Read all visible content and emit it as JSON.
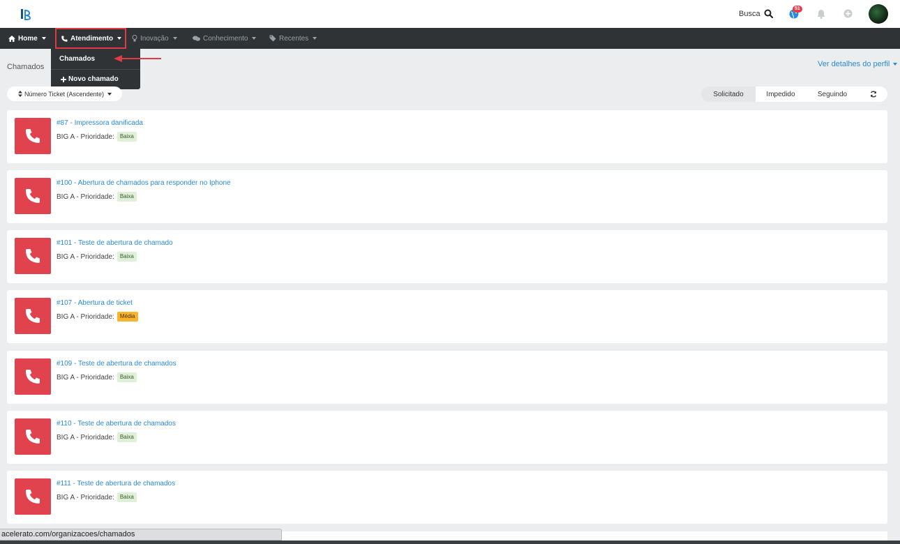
{
  "topbar": {
    "search_label": "Busca",
    "notification_count": "51",
    "icons": [
      "logo-icon",
      "search-icon",
      "globe-icon",
      "bell-icon",
      "plus-circle-icon",
      "avatar"
    ]
  },
  "nav": {
    "items": [
      {
        "label": "Home",
        "icon": "home-icon",
        "active": true
      },
      {
        "label": "Atendimento",
        "icon": "phone-icon",
        "active": true
      },
      {
        "label": "Inovação",
        "icon": "lightbulb-icon",
        "active": false
      },
      {
        "label": "Conhecimento",
        "icon": "comments-icon",
        "active": false
      },
      {
        "label": "Recentes",
        "icon": "tag-icon",
        "active": false
      }
    ],
    "dropdown": {
      "items": [
        {
          "label": "Chamados"
        },
        {
          "label": "Novo chamado",
          "icon": "plus-icon"
        }
      ]
    }
  },
  "page": {
    "breadcrumb": "Chamados",
    "profile_link": "Ver detalhes do perfil",
    "sort_label": "Número Ticket (Ascendente)",
    "tabs": [
      "Solicitado",
      "Impedido",
      "Seguindo"
    ],
    "selected_tab": "Solicitado"
  },
  "tickets": [
    {
      "title": "#87 - Impressora danificada",
      "org": "BIG A - Prioridade:",
      "priority": "Baixa"
    },
    {
      "title": "#100 - Abertura de chamados para responder no Iphone",
      "org": "BIG A - Prioridade:",
      "priority": "Baixa"
    },
    {
      "title": "#101 - Teste de abertura de chamado",
      "org": "BIG A - Prioridade:",
      "priority": "Baixa"
    },
    {
      "title": "#107 - Abertura de ticket",
      "org": "BIG A - Prioridade:",
      "priority": "Média"
    },
    {
      "title": "#109 - Teste de abertura de chamados",
      "org": "BIG A - Prioridade:",
      "priority": "Baixa"
    },
    {
      "title": "#110 - Teste de abertura de chamados",
      "org": "BIG A - Prioridade:",
      "priority": "Baixa"
    },
    {
      "title": "#111 - Teste de abertura de chamados",
      "org": "BIG A - Prioridade:",
      "priority": "Baixa"
    }
  ],
  "statusbar": {
    "url": "acelerato.com/organizacoes/chamados"
  },
  "colors": {
    "accent_blue": "#2a8ad8",
    "ticket_icon_red": "#e0434e",
    "highlight_red": "#e03a45",
    "navbar_dark": "#2f3335",
    "priority_low_bg": "#dff0d8",
    "priority_medium_bg": "#f7b42c"
  }
}
